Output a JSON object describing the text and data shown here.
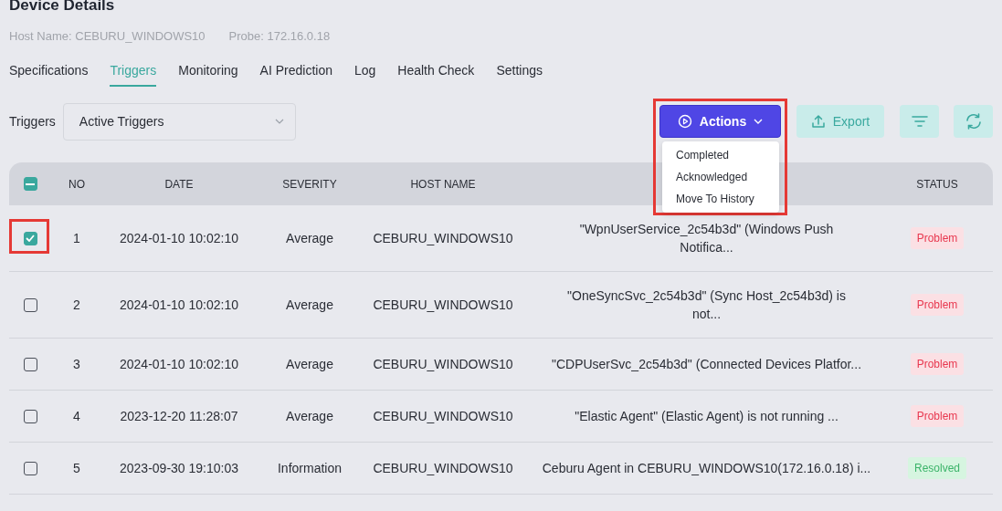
{
  "title": "Device Details",
  "meta": [
    {
      "label": "Host Name: CEBURU_WINDOWS10"
    },
    {
      "label": "Probe: 172.16.0.18"
    }
  ],
  "tabs": [
    {
      "label": "Specifications",
      "selected": false
    },
    {
      "label": "Triggers",
      "selected": true
    },
    {
      "label": "Monitoring",
      "selected": false
    },
    {
      "label": "AI Prediction",
      "selected": false
    },
    {
      "label": "Log",
      "selected": false
    },
    {
      "label": "Health Check",
      "selected": false
    },
    {
      "label": "Settings",
      "selected": false
    }
  ],
  "filter": {
    "label": "Triggers",
    "value": "Active Triggers"
  },
  "actions": {
    "label": "Actions",
    "expanded": true,
    "highlighted": true,
    "menu": [
      "Completed",
      "Acknowledged",
      "Move To History"
    ]
  },
  "export": {
    "label": "Export"
  },
  "table": {
    "select_all": {
      "checked": true,
      "partial": true
    },
    "columns": [
      "NO",
      "DATE",
      "SEVERITY",
      "HOST NAME",
      "",
      "STATUS"
    ],
    "rows": [
      {
        "checked": true,
        "highlighted": true,
        "no": "1",
        "date": "2024-01-10 10:02:10",
        "severity": "Average",
        "host": "CEBURU_WINDOWS10",
        "description": [
          "\"WpnUserService_2c54b3d\" (Windows Push",
          "Notifica..."
        ],
        "status": "Problem",
        "kind": "problem"
      },
      {
        "checked": false,
        "highlighted": false,
        "no": "2",
        "date": "2024-01-10 10:02:10",
        "severity": "Average",
        "host": "CEBURU_WINDOWS10",
        "description": [
          "\"OneSyncSvc_2c54b3d\" (Sync Host_2c54b3d) is",
          "not..."
        ],
        "status": "Problem",
        "kind": "problem"
      },
      {
        "checked": false,
        "highlighted": false,
        "no": "3",
        "date": "2024-01-10 10:02:10",
        "severity": "Average",
        "host": "CEBURU_WINDOWS10",
        "description": [
          "\"CDPUserSvc_2c54b3d\" (Connected Devices Platfor..."
        ],
        "status": "Problem",
        "kind": "problem"
      },
      {
        "checked": false,
        "highlighted": false,
        "no": "4",
        "date": "2023-12-20 11:28:07",
        "severity": "Average",
        "host": "CEBURU_WINDOWS10",
        "description": [
          "\"Elastic Agent\" (Elastic Agent) is not running ..."
        ],
        "status": "Problem",
        "kind": "problem"
      },
      {
        "checked": false,
        "highlighted": false,
        "no": "5",
        "date": "2023-09-30 19:10:03",
        "severity": "Information",
        "host": "CEBURU_WINDOWS10",
        "description": [
          "Ceburu Agent in CEBURU_WINDOWS10(172.16.0.18) i..."
        ],
        "status": "Resolved",
        "kind": "resolved"
      }
    ]
  }
}
